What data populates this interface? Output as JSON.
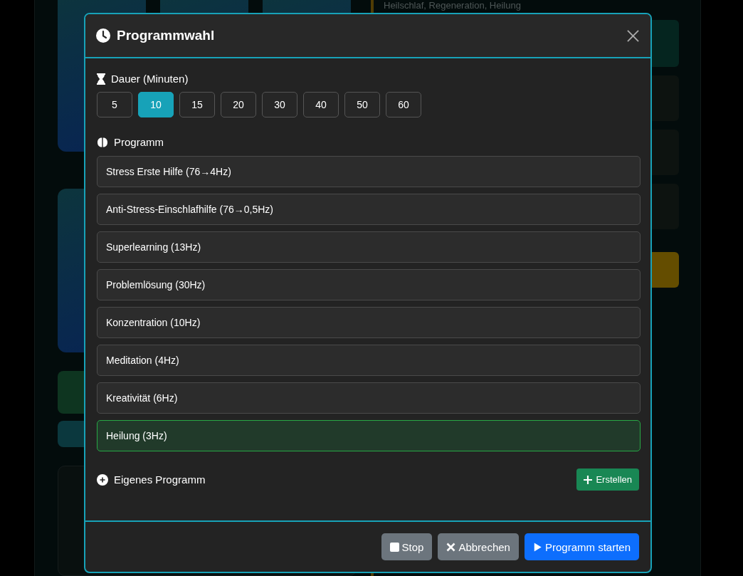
{
  "background": {
    "subtitle": "Heilschlaf, Regeneration, Heilung"
  },
  "dialog": {
    "title": "Programmwahl",
    "duration": {
      "label": "Dauer (Minuten)",
      "options": [
        {
          "label": "5",
          "selected": false
        },
        {
          "label": "10",
          "selected": true
        },
        {
          "label": "15",
          "selected": false
        },
        {
          "label": "20",
          "selected": false
        },
        {
          "label": "30",
          "selected": false
        },
        {
          "label": "40",
          "selected": false
        },
        {
          "label": "50",
          "selected": false
        },
        {
          "label": "60",
          "selected": false
        }
      ]
    },
    "program": {
      "label": "Programm",
      "items": [
        {
          "label": "Stress Erste Hilfe (76→4Hz)",
          "selected": false
        },
        {
          "label": "Anti-Stress-Einschlafhilfe (76→0,5Hz)",
          "selected": false
        },
        {
          "label": "Superlearning (13Hz)",
          "selected": false
        },
        {
          "label": "Problemlösung (30Hz)",
          "selected": false
        },
        {
          "label": "Konzentration (10Hz)",
          "selected": false
        },
        {
          "label": "Meditation (4Hz)",
          "selected": false
        },
        {
          "label": "Kreativität (6Hz)",
          "selected": false
        },
        {
          "label": "Heilung (3Hz)",
          "selected": true
        }
      ]
    },
    "custom": {
      "label": "Eigenes Programm",
      "button": "Erstellen"
    },
    "buttons": [
      {
        "kind": "stop",
        "label": "Stop"
      },
      {
        "kind": "cancel",
        "label": "Abbrechen"
      },
      {
        "kind": "start",
        "label": "Programm starten"
      }
    ]
  }
}
